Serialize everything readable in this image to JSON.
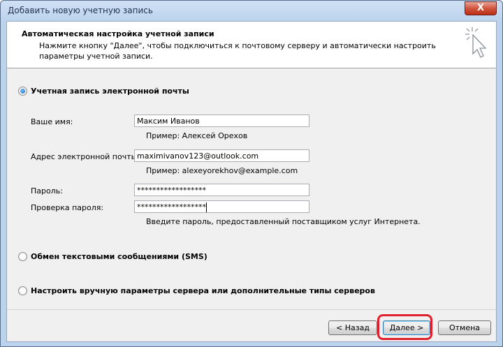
{
  "window": {
    "title": "Добавить новую учетную запись",
    "close_label": "X"
  },
  "header": {
    "title": "Автоматическая настройка учетной записи",
    "description": "Нажмите кнопку \"Далее\", чтобы подключиться к почтовому серверу и автоматически настроить параметры учетной записи."
  },
  "options": {
    "email_account": {
      "label": "Учетная запись электронной почты",
      "selected": true
    },
    "sms": {
      "label": "Обмен текстовыми сообщениями (SMS)",
      "selected": false
    },
    "manual": {
      "label": "Настроить вручную параметры сервера или дополнительные типы серверов",
      "selected": false
    }
  },
  "form": {
    "name": {
      "label": "Ваше имя:",
      "value": "Максим Иванов",
      "hint": "Пример: Алексей Орехов"
    },
    "email": {
      "label": "Адрес электронной почты:",
      "value": "maximivanov123@outlook.com",
      "hint": "Пример: alexeyorekhov@example.com"
    },
    "password": {
      "label": "Пароль:",
      "value": "******************"
    },
    "password_confirm": {
      "label": "Проверка пароля:",
      "value": "******************"
    },
    "password_hint": "Введите пароль, предоставленный поставщиком услуг Интернета."
  },
  "buttons": {
    "back": "< Назад",
    "next": "Далее >",
    "cancel": "Отмена"
  },
  "colors": {
    "highlight": "#e0202c",
    "selected_radio": "#1a5fb4"
  },
  "icons": {
    "header_icon": "cursor-click-icon"
  }
}
